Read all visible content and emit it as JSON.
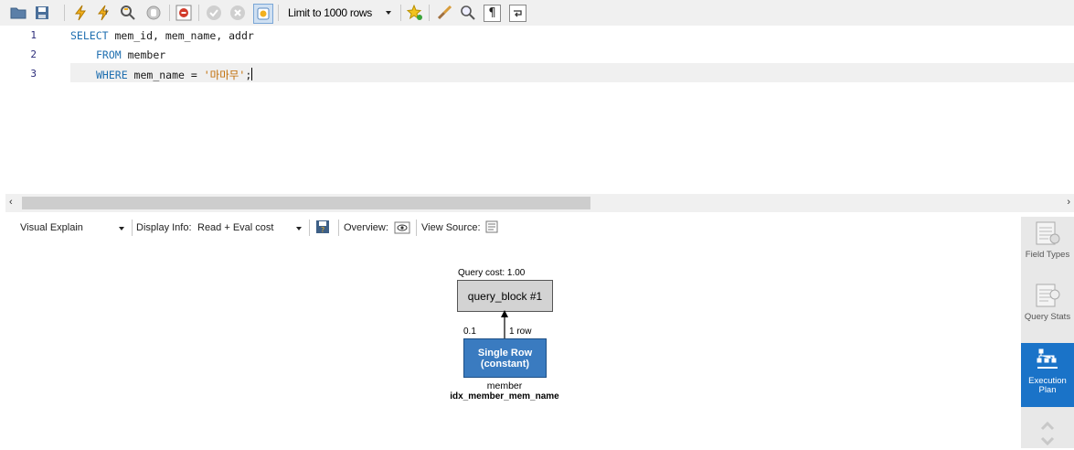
{
  "toolbar": {
    "limit_select": "Limit to 1000 rows",
    "icons": [
      "open-folder-icon",
      "save-icon",
      "execute-icon",
      "execute-current-icon",
      "explain-icon",
      "stop-icon",
      "toggle-error-icon",
      "commit-icon",
      "rollback-icon",
      "autocommit-icon",
      "beautify-star-icon",
      "brush-icon",
      "find-icon",
      "invisible-chars-icon",
      "wrap-icon"
    ]
  },
  "editor": {
    "line_numbers": [
      "1",
      "2",
      "3"
    ],
    "lines": [
      {
        "kw": "SELECT",
        "rest": " mem_id, mem_name, addr"
      },
      {
        "kw": "FROM",
        "rest": " member"
      },
      {
        "kw": "WHERE",
        "rest": " mem_name = ",
        "str": "'마마무'",
        "tail": ";"
      }
    ]
  },
  "explain_bar": {
    "mode": "Visual Explain",
    "display_info_label": "Display Info:",
    "display_info_value": "Read + Eval cost",
    "overview_label": "Overview:",
    "view_source_label": "View Source:"
  },
  "plan": {
    "query_cost": "Query cost: 1.00",
    "query_block": "query_block #1",
    "left_label": "0.1",
    "right_label": "1 row",
    "node_line1": "Single Row",
    "node_line2": "(constant)",
    "table_name": "member",
    "index_name": "idx_member_mem_name",
    "node_color": "#3a7bc0"
  },
  "sidebar": {
    "field_types": "Field Types",
    "query_stats": "Query Stats",
    "execution_plan": "Execution Plan",
    "active_color": "#1a73c8"
  }
}
